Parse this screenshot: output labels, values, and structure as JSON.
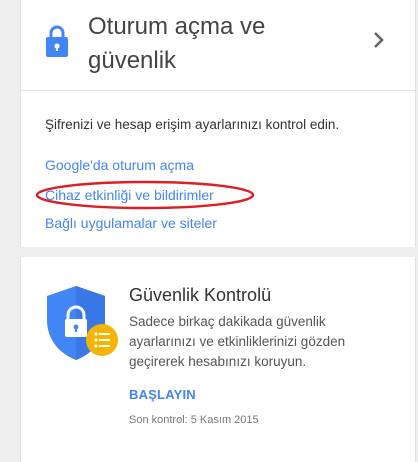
{
  "signin_card": {
    "title": "Oturum açma ve güvenlik",
    "description": "Şifrenizi ve hesap erişim ayarlarınızı kontrol edin.",
    "links": [
      {
        "label": "Google'da oturum açma"
      },
      {
        "label": "Cihaz etkinliği ve bildirimler"
      },
      {
        "label": "Bağlı uygulamalar ve siteler"
      }
    ],
    "highlight_color": "#dd1f26"
  },
  "security_card": {
    "title": "Güvenlik Kontrolü",
    "description": "Sadece birkaç dakikada güvenlik ayarlarınızı ve etkinliklerinizi gözden geçirerek hesabınızı koruyun.",
    "action_label": "BAŞLAYIN",
    "last_check": "Son kontrol: 5 Kasım 2015"
  },
  "colors": {
    "accent": "#4285f4",
    "badge": "#f4b400"
  }
}
